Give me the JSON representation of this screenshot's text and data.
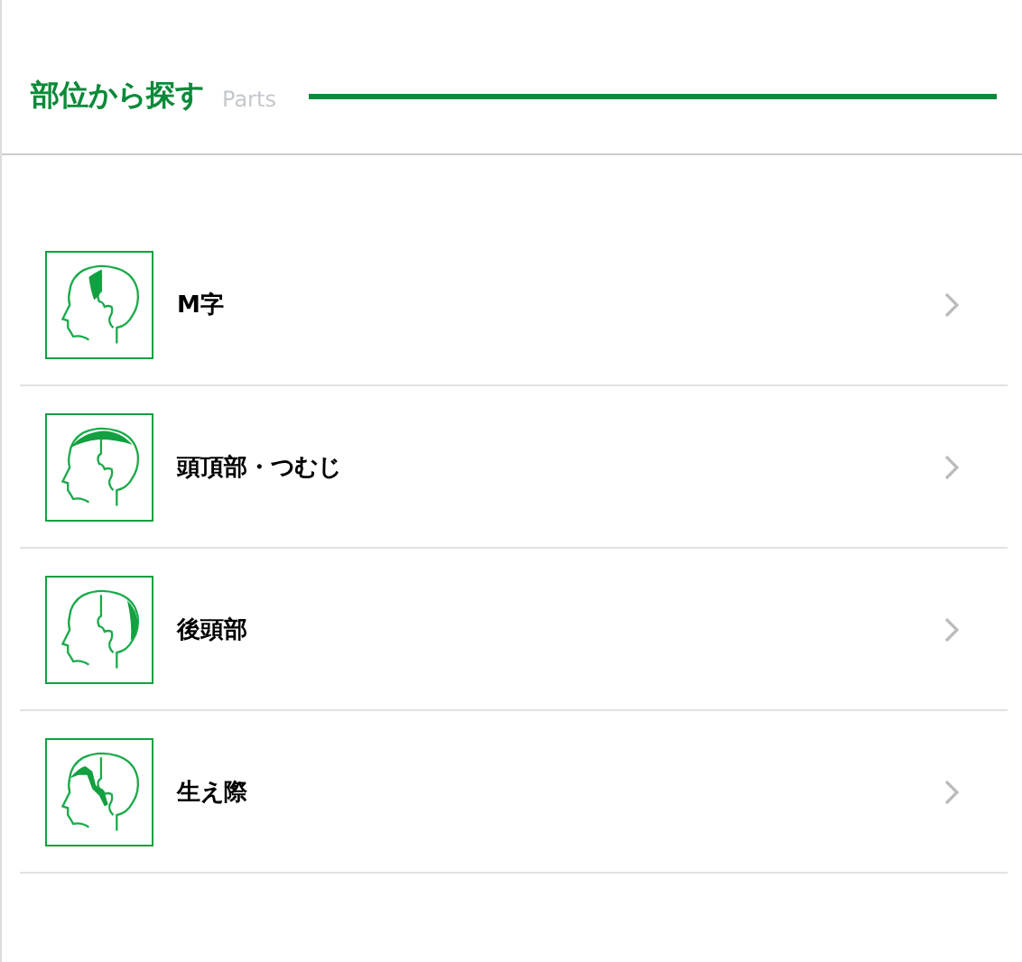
{
  "header": {
    "title": "部位から探す",
    "subtitle": "Parts"
  },
  "parts": [
    {
      "label": "M字",
      "kind": "m"
    },
    {
      "label": "頭頂部・つむじ",
      "kind": "crown"
    },
    {
      "label": "後頭部",
      "kind": "back"
    },
    {
      "label": "生え際",
      "kind": "hairline"
    }
  ]
}
